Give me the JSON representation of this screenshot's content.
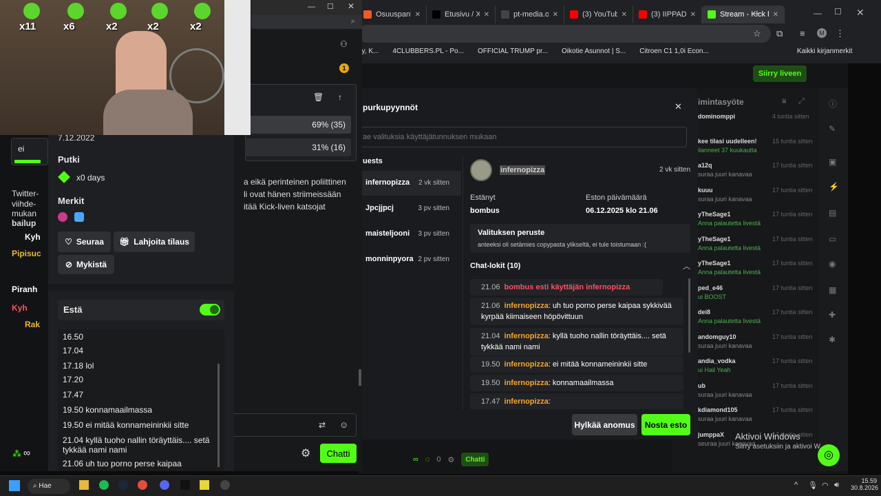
{
  "browser": {
    "tabs": [
      {
        "label": "Osuuspank",
        "color": "#f05a28"
      },
      {
        "label": "Etusivu / X",
        "color": "#000000"
      },
      {
        "label": "pt-media.org",
        "color": "#444444"
      },
      {
        "label": "(3) YouTube",
        "color": "#ff0000"
      },
      {
        "label": "(3) IIPPADAA l",
        "color": "#ff0000"
      },
      {
        "label": "Stream - Kick l",
        "color": "#53fc18"
      }
    ],
    "bookmarks": [
      "ay, K...",
      "4CLUBBERS.PL - Po...",
      "OFFICIAL TRUMP pr...",
      "Oikotie Asunnot | S...",
      "Citroen C1 1,0i Econ...",
      "Kaikki kirjanmerkit"
    ],
    "go_live_label": "Siirry liveen"
  },
  "modal": {
    "title": "purkupyynnöt",
    "search_placeholder": "ae valituksia käyttäjätunnuksen mukaan",
    "list_header": "uests",
    "requests": [
      {
        "name": "infernopizza",
        "time": "2 vk sitten"
      },
      {
        "name": "Jpcjjpcj",
        "time": "3 pv sitten"
      },
      {
        "name": "maisteljooni",
        "time": "3 pv sitten"
      },
      {
        "name": "monninpyora",
        "time": "2 pv sitten"
      }
    ],
    "detail": {
      "username": "infernopizza",
      "time": "2 vk sitten",
      "banned_by_label": "Estänyt",
      "banned_by": "bombus",
      "ban_date_label": "Eston päivämäärä",
      "ban_date": "06.12.2025 klo 21.06",
      "reason_label": "Valituksen peruste",
      "reason": "anteeksi oli setämies copypasta ylikseltä, ei tule toistumaan :(",
      "chatlog_label": "Chat-lokit (10)",
      "chatlog": [
        {
          "time": "21.06",
          "user": "",
          "text": "bombus esti käyttäjän infernopizza",
          "system": true
        },
        {
          "time": "21.06",
          "user": "infernopizza",
          "text": ": uh tuo porno perse kaipaa sykkivää kyrpää kiimaiseen höpövittuun"
        },
        {
          "time": "21.04",
          "user": "infernopizza",
          "text": ": kyllä tuoho nallin töräyttäis.... setä tykkää nami nami"
        },
        {
          "time": "19.50",
          "user": "infernopizza",
          "text": ": ei mitää konnameininkii sitte"
        },
        {
          "time": "19.50",
          "user": "infernopizza",
          "text": ": konnamaailmassa"
        },
        {
          "time": "17.47",
          "user": "infernopizza",
          "text": ":"
        }
      ]
    },
    "deny_label": "Hylkää anomus",
    "unban_label": "Nosta esto"
  },
  "right_chat": {
    "header": "imintasyöte",
    "items": [
      {
        "a": "dominomppi",
        "b": "4 tuntia sitten"
      },
      {
        "a": "kee tilasi uudelleen!",
        "b": "15 tuntia sitten",
        "c": "ilanneet 37 kuukautta"
      },
      {
        "a": "a12q",
        "b": "17 tuntia sitten",
        "c": "suraa juuri kanavaa"
      },
      {
        "a": "kuuu",
        "b": "17 tuntia sitten",
        "c": "suraa juuri kanavaa"
      },
      {
        "a": "yTheSage1",
        "b": "17 tuntia sitten",
        "c": "Anna palautetta livestä"
      },
      {
        "a": "yTheSage1",
        "b": "17 tuntia sitten",
        "c": "Anna palautetta livestä"
      },
      {
        "a": "yTheSage1",
        "b": "17 tuntia sitten",
        "c": "Anna palautetta livestä"
      },
      {
        "a": "ped_e46",
        "b": "17 tuntia sitten",
        "c": "ui BOOST"
      },
      {
        "a": "dei8",
        "b": "17 tuntia sitten",
        "c": "Anna palautetta livestä"
      },
      {
        "a": "andomguy10",
        "b": "17 tuntia sitten",
        "c": "suraa juuri kanavaa"
      },
      {
        "a": "andia_vodka",
        "b": "17 tuntia sitten",
        "c": "ui Hail Yeah"
      },
      {
        "a": "ub",
        "b": "17 tuntia sitten",
        "c": "suraa juuri kanavaa"
      },
      {
        "a": "kdiamond105",
        "b": "17 tuntia sitten",
        "c": "suraa juuri kanavaa"
      },
      {
        "a": "jumppaX",
        "b": "17 tuntia sitten",
        "c": "seuraa juuri kanavaa"
      }
    ],
    "activate_title": "Aktivoi Windows",
    "activate_sub": "Siirry asetuksiin ja aktivoi W...s.",
    "bottom_chat_label": "Chatti",
    "bottom_count": "0"
  },
  "stream_overlay": [
    "x11",
    "x6",
    "x2",
    "x2",
    "x2"
  ],
  "popout": {
    "poll": [
      {
        "pct": "69% (35)"
      },
      {
        "pct": "31% (16)"
      }
    ],
    "poll_input": "ei",
    "chat_text": "a eikä perinteinen poliittinen\nli ovat hänen striimeissään\nitää Kick-liven katsojat",
    "chat_names": [
      "Twitter-",
      "viihde-",
      "mukan",
      "bailup",
      "Kyh",
      "Pipisuc",
      "Piranh",
      "Kyh",
      "Rak"
    ],
    "join_date": "7.12.2022",
    "streak_label": "Putki",
    "streak_value": "x0 days",
    "badges_label": "Merkit",
    "follow_label": "Seuraa",
    "gift_label": "Lahjoita tilaus",
    "mute_label": "Mykistä",
    "block_label": "Estä",
    "history": [
      {
        "text": "16.50"
      },
      {
        "text": "17.04"
      },
      {
        "text": "17.18 lol"
      },
      {
        "text": "17.20"
      },
      {
        "text": "17.47"
      },
      {
        "text": "19.50 konnamaailmassa"
      },
      {
        "text": "19.50 ei mitää konnameininkii sitte"
      },
      {
        "text": "21.04 kyllä tuoho nallin töräyttäis.... setä tykkää nami nami"
      },
      {
        "text": "21.06 uh tuo porno perse kaipaa"
      }
    ],
    "chat_button": "Chatti"
  },
  "taskbar": {
    "search": "Hae",
    "time": "15.59",
    "date": "30.8.2026"
  },
  "colors": {
    "accent": "#53fc18",
    "danger": "#ff4f62",
    "orange": "#f5a623"
  }
}
